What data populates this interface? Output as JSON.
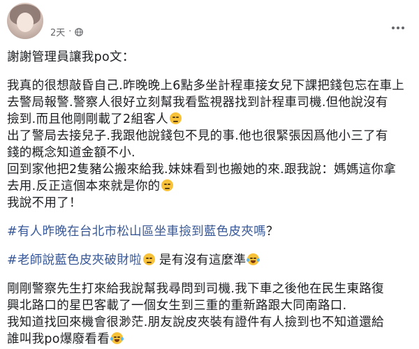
{
  "post": {
    "timestamp": "2天",
    "separator": "·",
    "privacy_icon": "globe-icon",
    "more_icon": "more-options-icon",
    "lines": {
      "l1": "謝謝管理員讓我po文：",
      "l2": "我真的很想敲昏自己.昨晚晚上6點多坐計程車接女兒下課把錢包忘在車上",
      "l3": "去警局報警.警察人很好立刻幫我看監視器找到計程車司機.但他說沒有撿到.而且他剛剛載了2組客人",
      "l4": "出了警局去接兒子.我跟他說錢包不見的事.他也很緊張因爲他小三了有錢的概念知道金額不小.",
      "l5": "回到家他把2隻豬公搬來給我.妹妹看到也搬她的來.跟我說：媽媽這你拿去用.反正這個本來就是你的",
      "l6": "我說不用了！",
      "l7_tag": "#有人昨晚在台北市松山區坐車撿到藍色皮夾嗎",
      "l7_tail": "？",
      "l8_tag": "#老師說藍色皮夾破財啦",
      "l8_tail": "是有沒有這麼準",
      "l9": "剛剛警察先生打來給我說幫我尋問到司機.我下車之後他在民生東路復興北路口的星巴客載了一個女生到三重的重新路跟大同南路口.",
      "l10": "我知道找回來機會很渺茫.朋友說皮夾裝有證件有人撿到也不知道還給誰叫我po爆廢看看"
    },
    "display_lines": [
      "謝謝管理員讓我po文：",
      "我真的很想敲昏自己.昨晚晚上6點多坐計程車接女兒下課把錢包忘在車上",
      "去警局報警.警察人很好立刻幫我看監視器找到計程車司機.但他說沒有",
      "撿到.而且他剛剛載了2組客人",
      "出了警局去接兒子.我跟他說錢包不見的事.他也很緊張因爲他小三了有",
      "錢的概念知道金額不小.",
      "回到家他把2隻豬公搬來給我.妹妹看到也搬她的來.跟我說：媽媽這你拿",
      "去用.反正這個本來就是你的",
      "我說不用了！",
      "#有人昨晚在台北市松山區坐車撿到藍色皮夾嗎",
      "？",
      "#老師說藍色皮夾破財啦",
      "是有沒有這麼準",
      "剛剛警察先生打來給我說幫我尋問到司機.我下車之後他在民生東路復",
      "興北路口的星巴客載了一個女生到三重的重新路跟大同南路口.",
      "我知道找回來機會很渺茫.朋友說皮夾裝有證件有人撿到也不知道還給",
      "誰叫我po爆廢看看"
    ],
    "emoji": {
      "sad": "sad-face-emoji",
      "laugh": "tears-of-joy-emoji"
    },
    "colors": {
      "text": "#1c1e21",
      "meta": "#65676b",
      "hashtag": "#385898"
    }
  }
}
